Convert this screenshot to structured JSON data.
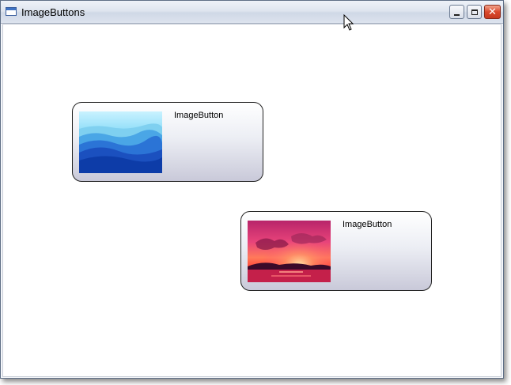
{
  "window": {
    "title": "ImageButtons",
    "controls": [
      "minimize",
      "maximize",
      "close"
    ],
    "close_glyph": "✕"
  },
  "buttons": [
    {
      "label": "ImageButton",
      "image": "blue-mountains-image"
    },
    {
      "label": "ImageButton",
      "image": "sunset-image"
    }
  ],
  "colors": {
    "close_button": "#d9482c",
    "title_bar": "#dfe5ef",
    "button_border": "#222222"
  }
}
